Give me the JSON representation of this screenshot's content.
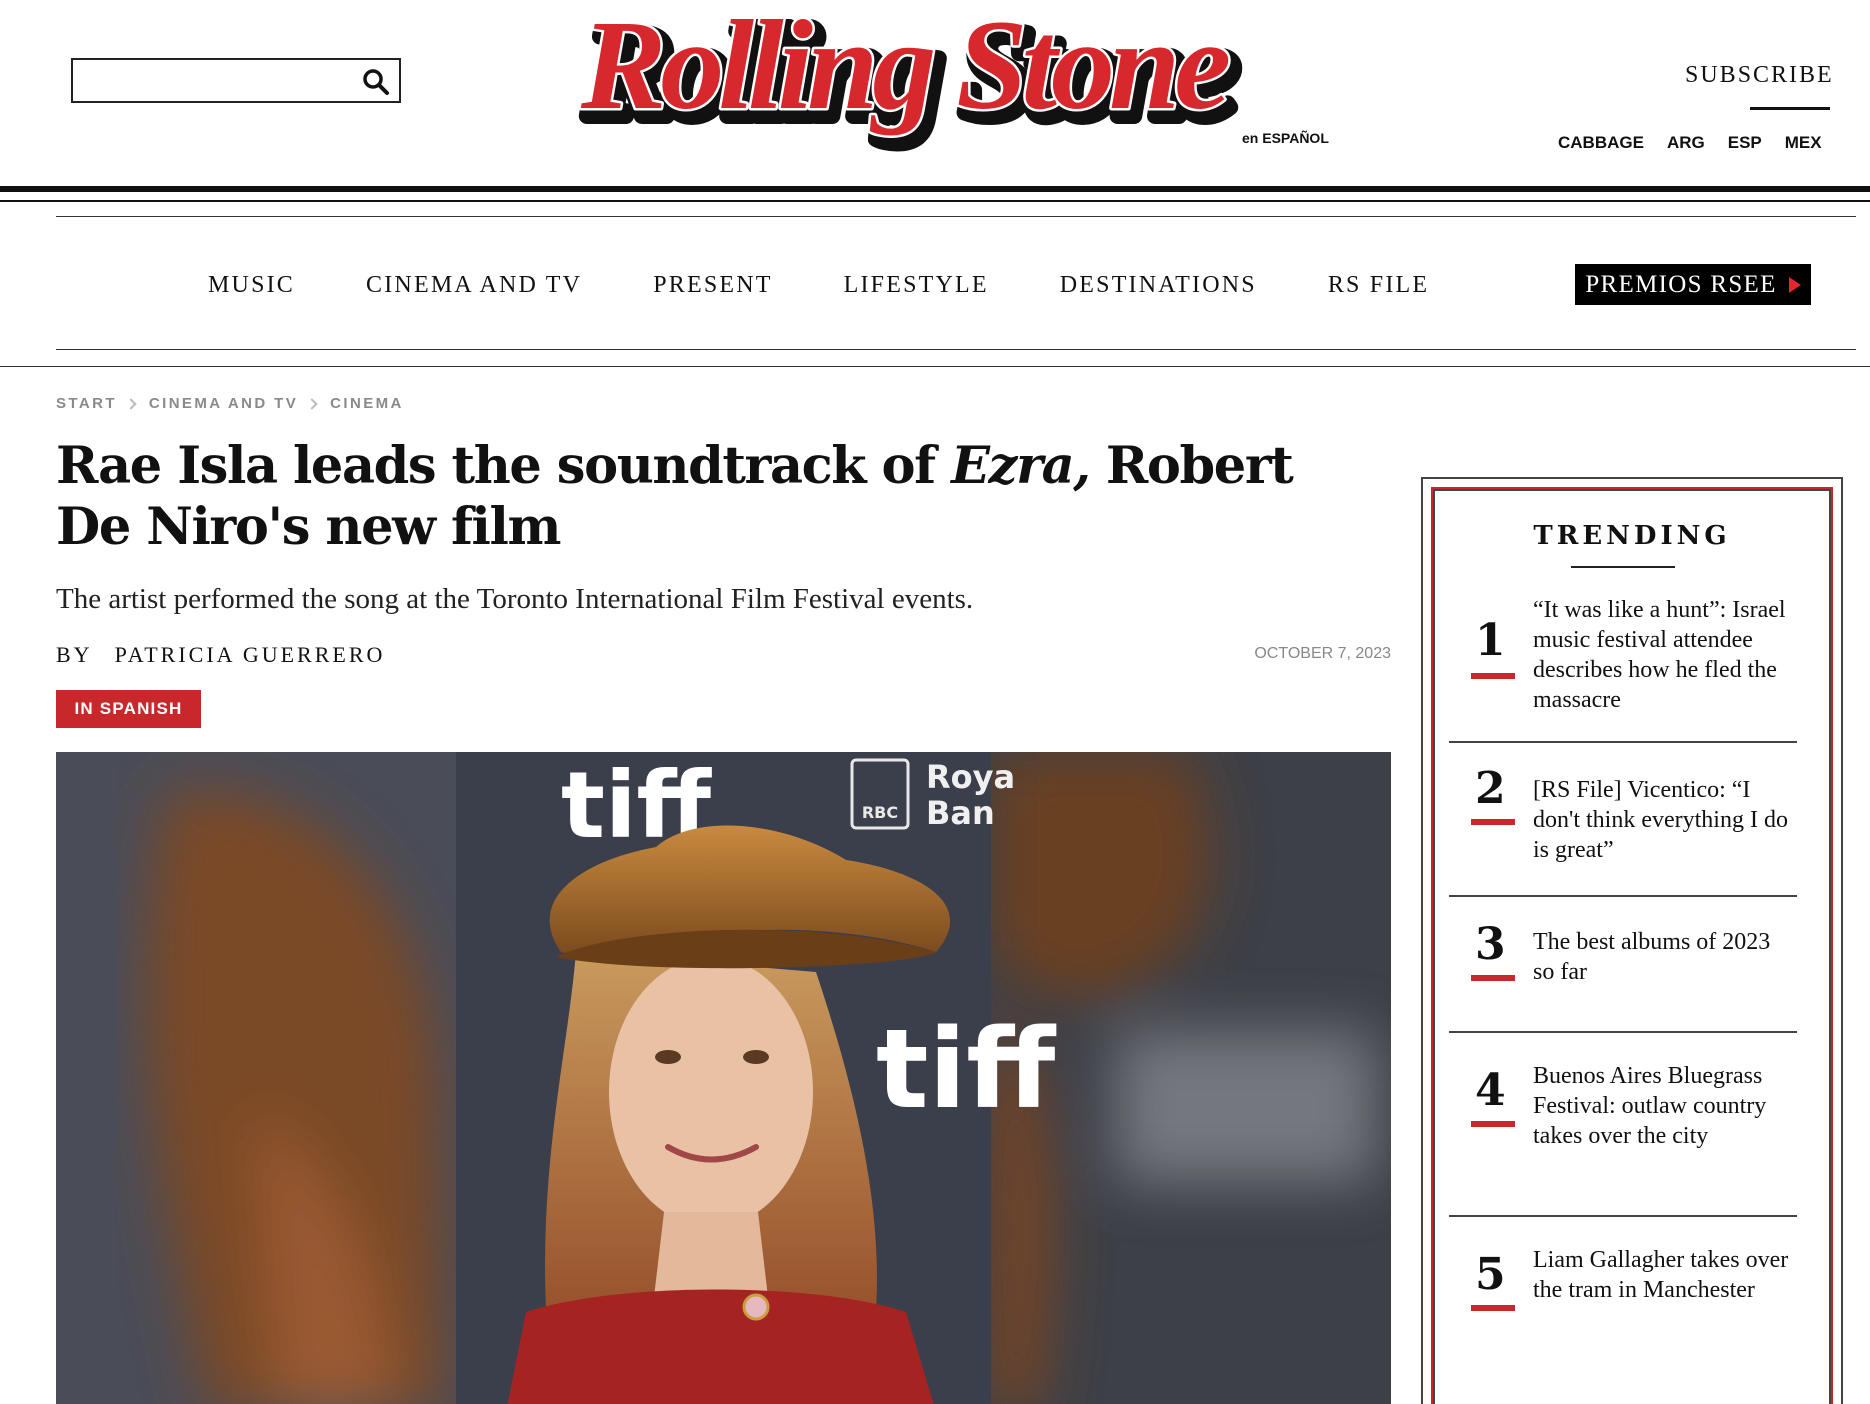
{
  "search": {
    "placeholder": "",
    "icon": "search-icon"
  },
  "brand": {
    "logo_text": "Rolling Stone",
    "logo_sub": "en ESPAÑOL",
    "logo_red": "#d7282e"
  },
  "header": {
    "subscribe_label": "SUBSCRIBE",
    "editions": [
      "CABBAGE",
      "ARG",
      "ESP",
      "MEX"
    ]
  },
  "nav": {
    "items": [
      "MUSIC",
      "CINEMA AND TV",
      "PRESENT",
      "LIFESTYLE",
      "DESTINATIONS",
      "RS FILE"
    ],
    "promo_label": "PREMIOS RSEE"
  },
  "breadcrumb": [
    "START",
    "CINEMA AND TV",
    "CINEMA"
  ],
  "article": {
    "headline_part1": "Rae Isla leads the soundtrack of ",
    "headline_italic": "Ezra,",
    "headline_part2": " Robert De Niro's new film",
    "dek": "The artist performed the song at the Toronto International Film Festival events.",
    "byline_prefix": "BY",
    "author": "PATRICIA GUERRERO",
    "date": "OCTOBER 7, 2023",
    "language_badge": "IN SPANISH",
    "accent_color": "#c8282c"
  },
  "hero_image": {
    "backdrop_text_1": "tiff",
    "backdrop_text_2": "RBC",
    "backdrop_text_3": "Roya",
    "backdrop_text_4": "Ban",
    "backdrop_text_5": "tiff"
  },
  "trending": {
    "title": "TRENDING",
    "items": [
      {
        "rank": "1",
        "text": "“It was like a hunt”: Israel music festival attendee describes how he fled the massacre"
      },
      {
        "rank": "2",
        "text": "[RS File] Vicentico: “I don't think everything I do is great”"
      },
      {
        "rank": "3",
        "text": "The best albums of 2023 so far"
      },
      {
        "rank": "4",
        "text": "Buenos Aires Bluegrass Festival: outlaw country takes over the city"
      },
      {
        "rank": "5",
        "text": "Liam Gallagher takes over the tram in Manchester"
      }
    ]
  }
}
